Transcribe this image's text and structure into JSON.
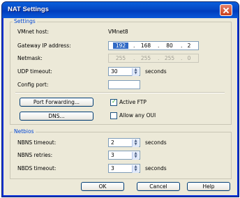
{
  "window": {
    "title": "NAT Settings"
  },
  "settings": {
    "group_label": "Settings",
    "vmnet_host_label": "VMnet host:",
    "vmnet_host_value": "VMnet8",
    "gateway_label": "Gateway IP address:",
    "gateway_ip": [
      "192",
      "168",
      "80",
      "2"
    ],
    "netmask_label": "Netmask:",
    "netmask": [
      "255",
      "255",
      "255",
      "0"
    ],
    "udp_timeout_label": "UDP timeout:",
    "udp_timeout_value": "30",
    "udp_timeout_unit": "seconds",
    "config_port_label": "Config port:",
    "config_port_value": "",
    "port_forwarding_button": "Port Forwarding...",
    "dns_button": "DNS...",
    "active_ftp_label": "Active FTP",
    "active_ftp_checked": true,
    "allow_oui_label": "Allow any OUI",
    "allow_oui_checked": false
  },
  "netbios": {
    "group_label": "Netbios",
    "nbns_timeout_label": "NBNS timeout:",
    "nbns_timeout_value": "2",
    "nbns_timeout_unit": "seconds",
    "nbns_retries_label": "NBNS retries:",
    "nbns_retries_value": "3",
    "nbds_timeout_label": "NBDS timeout:",
    "nbds_timeout_value": "3",
    "nbds_timeout_unit": "seconds"
  },
  "buttons": {
    "ok": "OK",
    "cancel": "Cancel",
    "help": "Help"
  },
  "icons": {
    "spinner_up": "▲",
    "spinner_down": "▼",
    "check": "✓"
  }
}
